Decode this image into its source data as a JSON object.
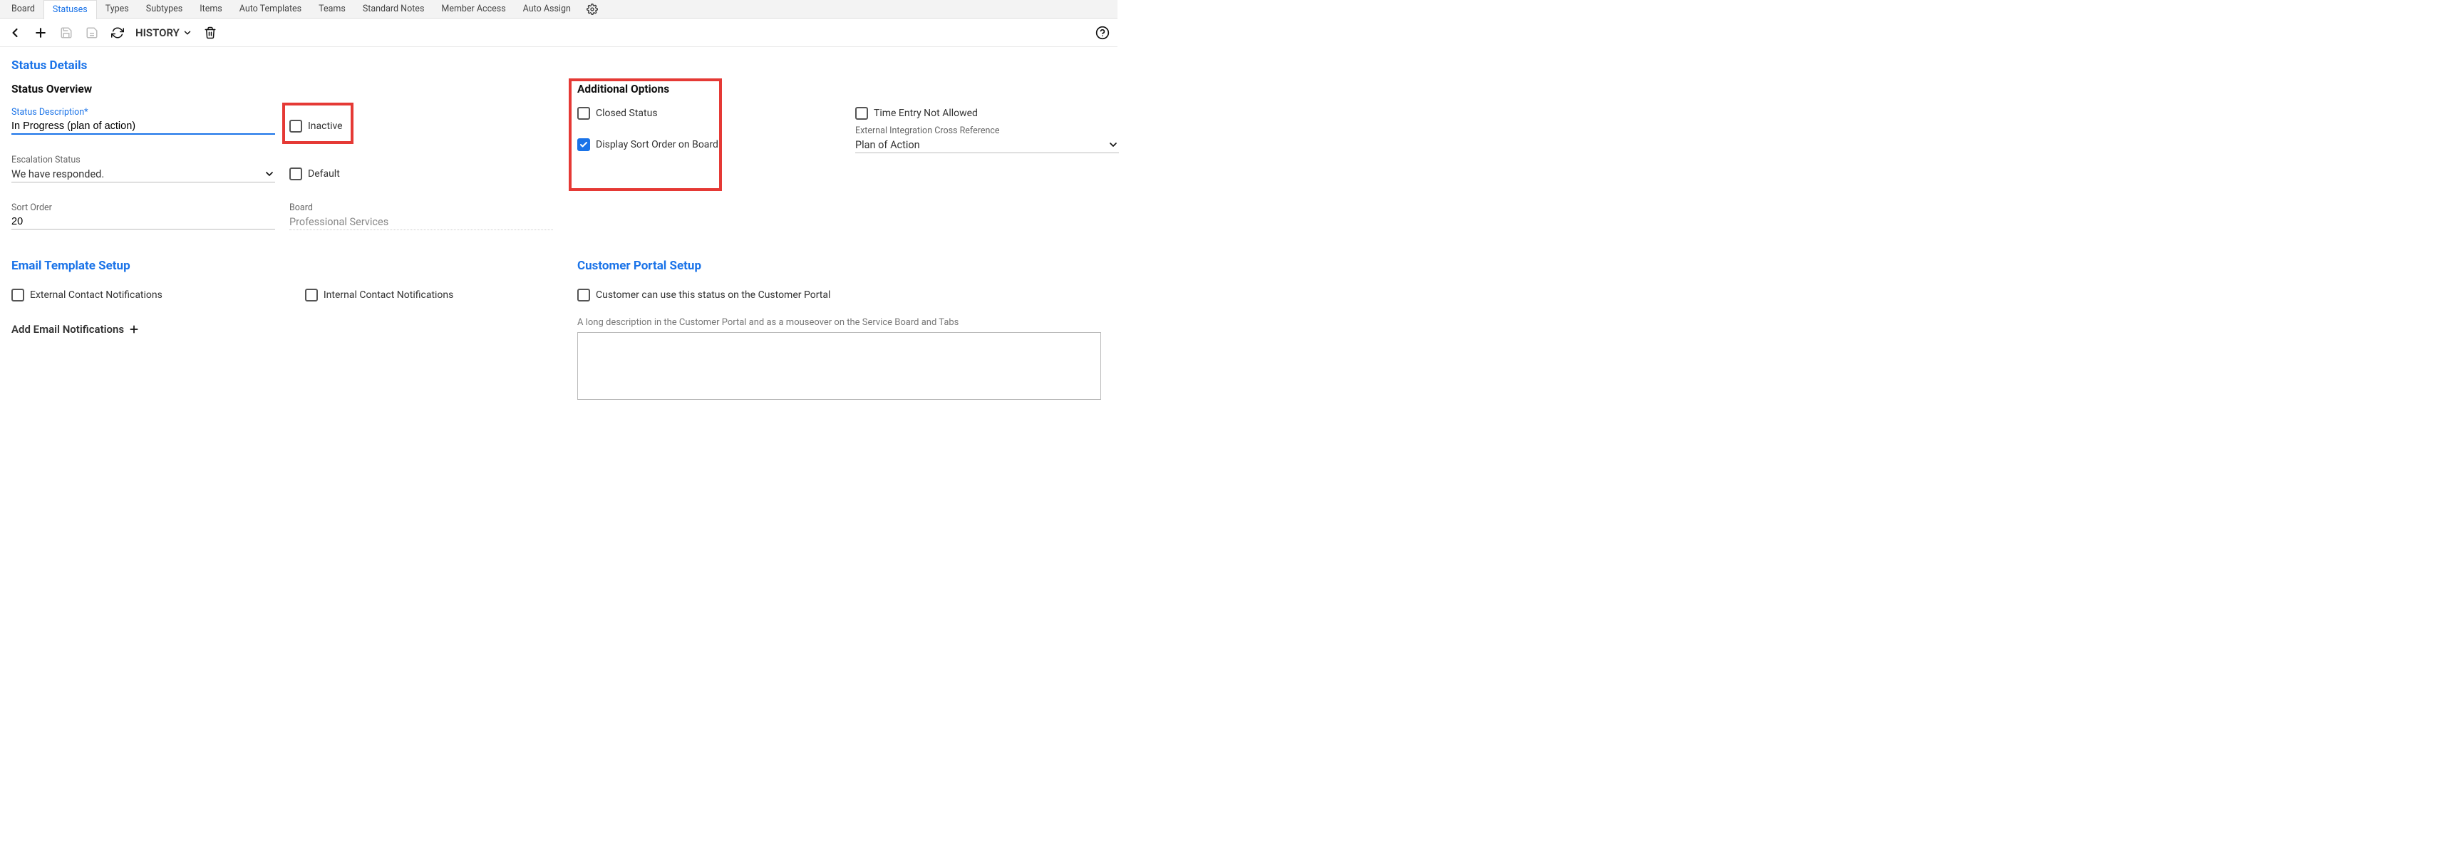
{
  "tabs": [
    "Board",
    "Statuses",
    "Types",
    "Subtypes",
    "Items",
    "Auto Templates",
    "Teams",
    "Standard Notes",
    "Member Access",
    "Auto Assign"
  ],
  "active_tab_index": 1,
  "toolbar": {
    "history_label": "HISTORY"
  },
  "status_details": {
    "title": "Status Details",
    "overview_heading": "Status Overview",
    "additional_heading": "Additional Options",
    "status_description_label": "Status Description*",
    "status_description_value": "In Progress (plan of action)",
    "inactive_label": "Inactive",
    "inactive_checked": false,
    "escalation_label": "Escalation Status",
    "escalation_value": "We have responded.",
    "default_label": "Default",
    "default_checked": false,
    "sort_order_label": "Sort Order",
    "sort_order_value": "20",
    "board_label": "Board",
    "board_value": "Professional Services",
    "closed_status_label": "Closed Status",
    "closed_status_checked": false,
    "time_entry_label": "Time Entry Not Allowed",
    "time_entry_checked": false,
    "display_sort_label": "Display Sort Order on Board",
    "display_sort_checked": true,
    "ext_integration_label": "External Integration Cross Reference",
    "ext_integration_value": "Plan of Action"
  },
  "email_template": {
    "title": "Email Template Setup",
    "external_label": "External Contact Notifications",
    "external_checked": false,
    "internal_label": "Internal Contact Notifications",
    "internal_checked": false,
    "add_label": "Add Email Notifications"
  },
  "customer_portal": {
    "title": "Customer Portal Setup",
    "allow_label": "Customer can use this status on the Customer Portal",
    "allow_checked": false,
    "textarea_label": "A long description in the Customer Portal and as a mouseover on the Service Board and Tabs",
    "textarea_value": ""
  }
}
